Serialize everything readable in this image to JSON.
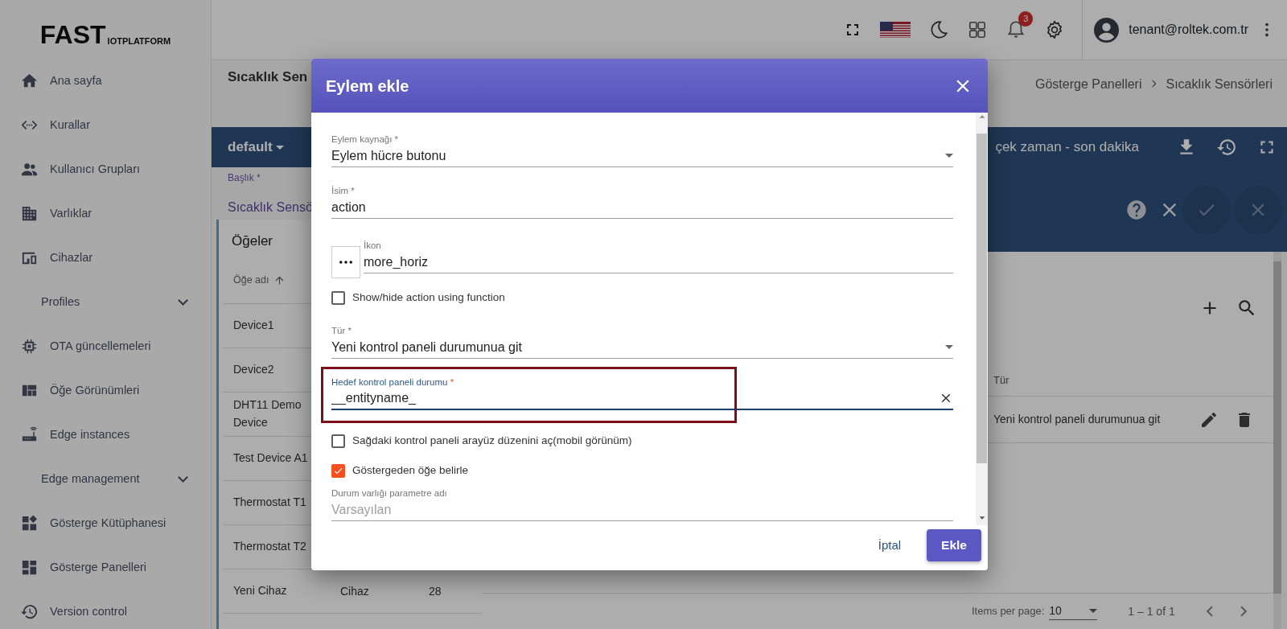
{
  "brand": {
    "name": "FAST",
    "tagline": "IOTPLATFORM"
  },
  "sidebar": {
    "items": [
      {
        "label": "Ana sayfa",
        "kind": "link"
      },
      {
        "label": "Kurallar",
        "kind": "link"
      },
      {
        "label": "Kullanıcı Grupları",
        "kind": "link"
      },
      {
        "label": "Varlıklar",
        "kind": "link"
      },
      {
        "label": "Cihazlar",
        "kind": "link"
      },
      {
        "label": "Profiles",
        "kind": "group",
        "expanded": false
      },
      {
        "label": "OTA güncellemeleri",
        "kind": "link"
      },
      {
        "label": "Öğe Görünümleri",
        "kind": "link"
      },
      {
        "label": "Edge instances",
        "kind": "link"
      },
      {
        "label": "Edge management",
        "kind": "group",
        "expanded": false
      },
      {
        "label": "Gösterge Kütüphanesi",
        "kind": "link"
      },
      {
        "label": "Gösterge Panelleri",
        "kind": "link"
      },
      {
        "label": "Version control",
        "kind": "link"
      }
    ]
  },
  "header": {
    "notifications": "3",
    "user": "tenant@roltek.com.tr"
  },
  "page": {
    "title": "Sıcaklık Sen",
    "breadcrumb": [
      "Gösterge Panelleri",
      "Sıcaklık Sensörleri"
    ]
  },
  "toolbar": {
    "state": "default",
    "timewindow": "çek zaman - son dakika"
  },
  "widget_title_field": {
    "label": "Başlık *",
    "value": "Sıcaklık Sensö"
  },
  "entities_panel": {
    "title": "Öğeler",
    "columns": [
      {
        "label": "Öğe adı",
        "sorted": true
      }
    ],
    "rows": [
      {
        "name": "Device1"
      },
      {
        "name": "Device2"
      },
      {
        "name": "DHT11 Demo Device"
      },
      {
        "name": "Test Device A1"
      },
      {
        "name": "Thermostat T1"
      },
      {
        "name": "Thermostat T2"
      },
      {
        "name": "Yeni Cihaz",
        "column_2": "Cihaz",
        "column_3": "28"
      }
    ]
  },
  "actions_table": {
    "columns": [
      "Tür"
    ],
    "rows": [
      {
        "type": "Yeni kontrol paneli durumunua git"
      }
    ],
    "paginator": {
      "label": "Items per page:",
      "page_size": "10",
      "range": "1 – 1 of 1"
    }
  },
  "dialog": {
    "title": "Eylem ekle",
    "fields": [
      {
        "kind": "select",
        "label": "Eylem kaynağı *",
        "value": "Eylem hücre butonu"
      },
      {
        "kind": "text",
        "label": "İsim *",
        "value": "action"
      },
      {
        "kind": "icon",
        "label": "İkon",
        "value": "more_horiz"
      },
      {
        "kind": "checkbox",
        "label": "Show/hide action using function",
        "checked": false
      },
      {
        "kind": "select",
        "label": "Tür *",
        "value": "Yeni kontrol paneli durumunua git"
      },
      {
        "kind": "text",
        "label": "Hedef kontrol paneli durumu",
        "required_mark": "*",
        "value": "__entityname_",
        "focused": true,
        "highlighted": true
      },
      {
        "kind": "checkbox",
        "label": "Sağdaki kontrol paneli arayüz düzenini aç(mobil görünüm)",
        "checked": false
      },
      {
        "kind": "checkbox",
        "label": "Göstergeden öğe belirle",
        "checked": true
      },
      {
        "kind": "text",
        "label": "Durum varlığı parametre adı",
        "placeholder": "Varsayılan"
      }
    ],
    "buttons": [
      {
        "label": "İptal",
        "kind": "text"
      },
      {
        "label": "Ekle",
        "kind": "primary"
      }
    ]
  }
}
